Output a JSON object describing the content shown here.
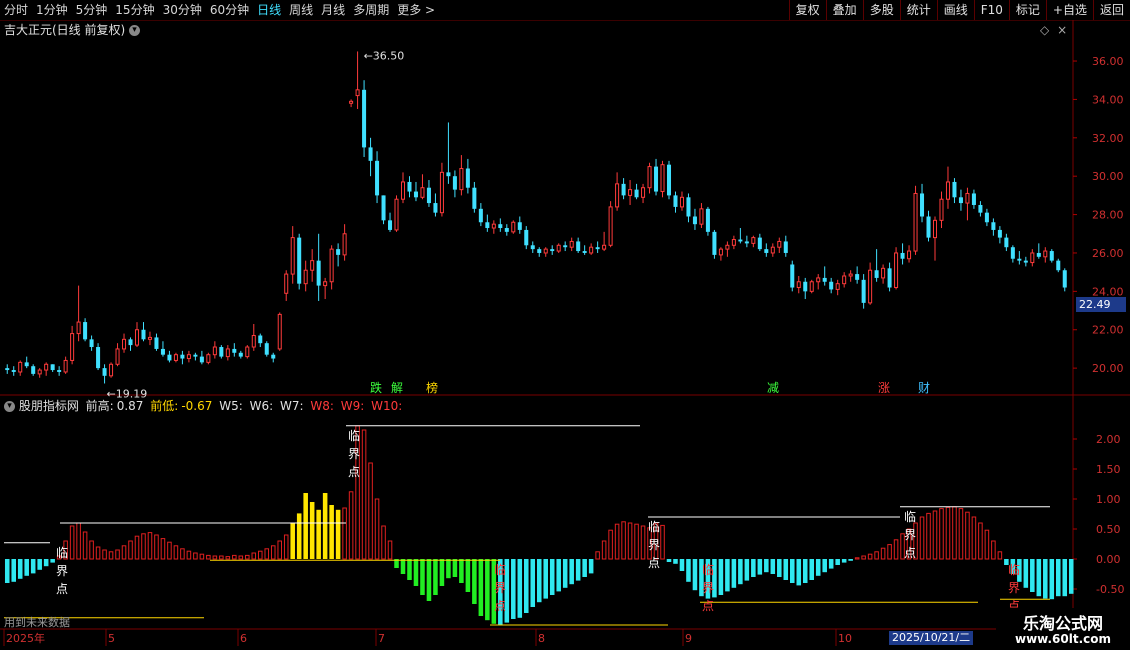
{
  "toolbar": {
    "periods": [
      "分时",
      "1分钟",
      "5分钟",
      "15分钟",
      "30分钟",
      "60分钟",
      "日线",
      "周线",
      "月线",
      "多周期",
      "更多 >"
    ],
    "active_period": "日线",
    "buttons": [
      "复权",
      "叠加",
      "多股",
      "统计",
      "画线",
      "F10",
      "标记",
      "+自选",
      "返回"
    ]
  },
  "main_header": {
    "title": "吉大正元(日线 前复权)"
  },
  "main_chart": {
    "ylim": [
      18.6,
      37.2
    ],
    "yticks": [
      "36.00",
      "34.00",
      "32.00",
      "30.00",
      "28.00",
      "26.00",
      "24.00",
      "22.00",
      "20.00"
    ],
    "ytick_values": [
      36,
      34,
      32,
      30,
      28,
      26,
      24,
      22,
      20
    ],
    "high_label": "36.50",
    "low_label": "19.19",
    "current_price": "22.49",
    "up_color": "#ff3b3b",
    "down_color": "#40e0ff",
    "event_labels": [
      {
        "text": "跌",
        "color": "#3cff3c"
      },
      {
        "text": "解",
        "color": "#3cff3c"
      },
      {
        "text": "榜",
        "color": "#ffd700"
      },
      {
        "text": "减",
        "color": "#3cff3c"
      },
      {
        "text": "涨",
        "color": "#ff3b3b"
      },
      {
        "text": "财",
        "color": "#40c0ff"
      }
    ]
  },
  "indicator_header": {
    "name": "股朋指标网",
    "prev_high_label": "前高:",
    "prev_high_value": "0.87",
    "prev_low_label": "前低:",
    "prev_low_value": "-0.67",
    "w5": "W5:",
    "w6": "W6:",
    "w7": "W7:",
    "w8": "W8:",
    "w9": "W9:",
    "w10": "W10:"
  },
  "indicator_chart": {
    "ylim": [
      -1.15,
      2.45
    ],
    "yticks": [
      "2.00",
      "1.50",
      "1.00",
      "0.50",
      "0.00",
      "-0.50"
    ],
    "ytick_values": [
      2.0,
      1.5,
      1.0,
      0.5,
      0.0,
      -0.5
    ],
    "marker_labels": [
      "临",
      "界",
      "点"
    ],
    "future_note": "用到未来数据"
  },
  "xaxis": {
    "labels": [
      "2025年",
      "5",
      "6",
      "7",
      "8",
      "9",
      "10"
    ],
    "cursor_date": "2025/10/21/二"
  },
  "watermark": {
    "title": "乐淘公式网",
    "url": "www.60lt.com"
  },
  "chart_data": {
    "type": "candlestick",
    "candles": [
      [
        20.0,
        20.2,
        19.7,
        19.9
      ],
      [
        19.9,
        20.1,
        19.6,
        19.8
      ],
      [
        19.8,
        20.4,
        19.6,
        20.3
      ],
      [
        20.3,
        20.6,
        20.0,
        20.1
      ],
      [
        20.1,
        20.2,
        19.6,
        19.7
      ],
      [
        19.7,
        20.0,
        19.5,
        19.9
      ],
      [
        19.9,
        20.3,
        19.6,
        20.2
      ],
      [
        20.2,
        20.2,
        19.8,
        19.9
      ],
      [
        19.9,
        20.1,
        19.6,
        19.8
      ],
      [
        19.8,
        20.6,
        19.7,
        20.4
      ],
      [
        20.4,
        22.2,
        20.2,
        21.8
      ],
      [
        21.8,
        24.3,
        21.4,
        22.4
      ],
      [
        22.4,
        22.6,
        21.4,
        21.5
      ],
      [
        21.5,
        21.7,
        20.9,
        21.1
      ],
      [
        21.1,
        21.3,
        19.9,
        20.0
      ],
      [
        20.0,
        20.2,
        19.2,
        19.6
      ],
      [
        19.6,
        20.3,
        19.5,
        20.2
      ],
      [
        20.2,
        21.3,
        20.1,
        21.0
      ],
      [
        21.0,
        21.8,
        20.8,
        21.5
      ],
      [
        21.5,
        21.6,
        20.9,
        21.2
      ],
      [
        21.2,
        22.4,
        21.1,
        22.0
      ],
      [
        22.0,
        22.4,
        21.4,
        21.5
      ],
      [
        21.5,
        21.9,
        21.2,
        21.6
      ],
      [
        21.6,
        21.8,
        20.9,
        21.0
      ],
      [
        21.0,
        21.4,
        20.6,
        20.7
      ],
      [
        20.7,
        20.9,
        20.3,
        20.4
      ],
      [
        20.4,
        20.8,
        20.3,
        20.7
      ],
      [
        20.7,
        20.9,
        20.2,
        20.5
      ],
      [
        20.5,
        20.9,
        20.3,
        20.7
      ],
      [
        20.7,
        20.8,
        20.4,
        20.6
      ],
      [
        20.6,
        20.9,
        20.2,
        20.3
      ],
      [
        20.3,
        20.8,
        20.2,
        20.7
      ],
      [
        20.7,
        21.4,
        20.5,
        21.1
      ],
      [
        21.1,
        21.2,
        20.5,
        20.6
      ],
      [
        20.6,
        21.2,
        20.4,
        21.0
      ],
      [
        21.0,
        21.3,
        20.6,
        20.8
      ],
      [
        20.8,
        20.9,
        20.5,
        20.6
      ],
      [
        20.6,
        21.2,
        20.5,
        21.1
      ],
      [
        21.1,
        22.3,
        20.9,
        21.7
      ],
      [
        21.7,
        21.8,
        21.1,
        21.3
      ],
      [
        21.3,
        21.4,
        20.6,
        20.7
      ],
      [
        20.7,
        20.8,
        20.3,
        20.5
      ],
      [
        21.0,
        22.9,
        20.9,
        22.8
      ],
      [
        23.9,
        25.1,
        23.5,
        24.9
      ],
      [
        24.9,
        27.4,
        24.4,
        26.8
      ],
      [
        26.8,
        27.0,
        24.1,
        24.4
      ],
      [
        24.4,
        25.6,
        24.0,
        25.1
      ],
      [
        25.1,
        26.2,
        24.5,
        25.6
      ],
      [
        25.6,
        27.0,
        23.5,
        24.3
      ],
      [
        24.3,
        24.7,
        23.6,
        24.5
      ],
      [
        24.5,
        26.4,
        24.1,
        26.2
      ],
      [
        26.2,
        26.5,
        25.3,
        25.9
      ],
      [
        25.9,
        27.5,
        25.6,
        27.0
      ],
      [
        33.8,
        34.0,
        33.6,
        33.9
      ],
      [
        34.2,
        36.5,
        33.5,
        34.5
      ],
      [
        34.5,
        35.0,
        31.0,
        31.5
      ],
      [
        31.5,
        32.0,
        30.0,
        30.8
      ],
      [
        30.8,
        31.3,
        28.6,
        29.0
      ],
      [
        29.0,
        29.0,
        27.5,
        27.7
      ],
      [
        27.7,
        28.1,
        27.1,
        27.2
      ],
      [
        27.2,
        29.0,
        27.1,
        28.8
      ],
      [
        28.8,
        30.2,
        28.6,
        29.7
      ],
      [
        29.7,
        30.0,
        28.9,
        29.2
      ],
      [
        29.2,
        29.7,
        28.7,
        28.9
      ],
      [
        28.9,
        30.1,
        28.8,
        29.4
      ],
      [
        29.4,
        29.8,
        28.4,
        28.6
      ],
      [
        28.6,
        29.1,
        27.9,
        28.1
      ],
      [
        28.1,
        30.7,
        27.9,
        30.2
      ],
      [
        30.2,
        32.8,
        29.6,
        30.0
      ],
      [
        30.0,
        30.3,
        28.9,
        29.3
      ],
      [
        29.3,
        31.1,
        29.0,
        30.4
      ],
      [
        30.4,
        30.9,
        29.1,
        29.4
      ],
      [
        29.4,
        29.7,
        28.1,
        28.3
      ],
      [
        28.3,
        28.6,
        27.4,
        27.6
      ],
      [
        27.6,
        28.0,
        27.1,
        27.3
      ],
      [
        27.3,
        27.7,
        27.0,
        27.5
      ],
      [
        27.5,
        27.8,
        27.1,
        27.3
      ],
      [
        27.3,
        27.5,
        26.9,
        27.1
      ],
      [
        27.1,
        27.7,
        27.0,
        27.6
      ],
      [
        27.6,
        27.9,
        27.0,
        27.2
      ],
      [
        27.2,
        27.4,
        26.2,
        26.4
      ],
      [
        26.4,
        26.6,
        26.0,
        26.2
      ],
      [
        26.2,
        26.3,
        25.8,
        26.0
      ],
      [
        26.0,
        26.3,
        25.8,
        26.2
      ],
      [
        26.2,
        26.4,
        25.9,
        26.1
      ],
      [
        26.1,
        26.5,
        26.0,
        26.4
      ],
      [
        26.4,
        26.6,
        26.1,
        26.3
      ],
      [
        26.3,
        26.8,
        26.1,
        26.6
      ],
      [
        26.6,
        26.8,
        26.0,
        26.1
      ],
      [
        26.1,
        26.4,
        25.9,
        26.0
      ],
      [
        26.0,
        26.5,
        25.9,
        26.3
      ],
      [
        26.3,
        26.6,
        26.0,
        26.2
      ],
      [
        26.2,
        27.1,
        26.1,
        26.4
      ],
      [
        26.4,
        28.7,
        26.3,
        28.4
      ],
      [
        28.4,
        30.2,
        28.2,
        29.6
      ],
      [
        29.6,
        29.9,
        28.8,
        29.0
      ],
      [
        29.0,
        29.8,
        28.5,
        29.3
      ],
      [
        29.3,
        29.6,
        28.8,
        28.9
      ],
      [
        28.9,
        29.6,
        28.6,
        29.4
      ],
      [
        29.4,
        30.7,
        29.1,
        30.5
      ],
      [
        30.5,
        30.9,
        29.0,
        29.2
      ],
      [
        29.2,
        30.8,
        28.9,
        30.6
      ],
      [
        30.6,
        30.8,
        28.8,
        29.0
      ],
      [
        29.0,
        29.2,
        28.1,
        28.4
      ],
      [
        28.4,
        29.2,
        28.2,
        28.9
      ],
      [
        28.9,
        29.1,
        27.6,
        27.9
      ],
      [
        27.9,
        28.3,
        27.2,
        27.5
      ],
      [
        27.5,
        28.6,
        27.3,
        28.3
      ],
      [
        28.3,
        28.4,
        26.9,
        27.1
      ],
      [
        27.1,
        27.2,
        25.7,
        25.9
      ],
      [
        25.9,
        26.3,
        25.6,
        26.2
      ],
      [
        26.2,
        26.6,
        25.8,
        26.4
      ],
      [
        26.4,
        26.9,
        26.2,
        26.7
      ],
      [
        26.7,
        27.3,
        26.5,
        26.6
      ],
      [
        26.6,
        26.9,
        26.3,
        26.5
      ],
      [
        26.5,
        26.9,
        26.3,
        26.8
      ],
      [
        26.8,
        27.0,
        26.1,
        26.2
      ],
      [
        26.2,
        26.5,
        25.8,
        26.0
      ],
      [
        26.0,
        26.5,
        25.8,
        26.3
      ],
      [
        26.3,
        26.8,
        26.0,
        26.6
      ],
      [
        26.6,
        26.9,
        25.8,
        26.0
      ],
      [
        25.4,
        25.6,
        24.0,
        24.2
      ],
      [
        24.2,
        24.8,
        23.9,
        24.5
      ],
      [
        24.5,
        24.7,
        23.6,
        24.0
      ],
      [
        24.0,
        24.6,
        23.9,
        24.5
      ],
      [
        24.5,
        24.9,
        24.1,
        24.7
      ],
      [
        24.7,
        25.3,
        24.3,
        24.5
      ],
      [
        24.5,
        24.7,
        23.9,
        24.1
      ],
      [
        24.1,
        24.6,
        23.8,
        24.4
      ],
      [
        24.4,
        25.0,
        24.2,
        24.8
      ],
      [
        24.8,
        25.1,
        24.5,
        24.9
      ],
      [
        24.9,
        25.3,
        24.4,
        24.6
      ],
      [
        24.6,
        24.9,
        23.1,
        23.4
      ],
      [
        23.4,
        25.5,
        23.3,
        25.1
      ],
      [
        25.1,
        26.2,
        24.5,
        24.7
      ],
      [
        24.7,
        25.4,
        24.4,
        25.2
      ],
      [
        25.2,
        25.5,
        24.0,
        24.2
      ],
      [
        24.2,
        26.3,
        24.1,
        26.0
      ],
      [
        26.0,
        26.5,
        25.4,
        25.7
      ],
      [
        25.7,
        26.4,
        25.5,
        26.1
      ],
      [
        26.1,
        29.5,
        25.9,
        29.1
      ],
      [
        29.1,
        29.6,
        27.6,
        27.9
      ],
      [
        27.9,
        28.2,
        26.6,
        26.8
      ],
      [
        26.8,
        27.9,
        25.6,
        27.7
      ],
      [
        27.7,
        29.2,
        27.3,
        28.8
      ],
      [
        28.8,
        30.5,
        28.3,
        29.7
      ],
      [
        29.7,
        29.9,
        28.6,
        28.9
      ],
      [
        28.9,
        29.3,
        28.2,
        28.6
      ],
      [
        28.6,
        29.4,
        27.7,
        29.1
      ],
      [
        29.1,
        29.3,
        28.3,
        28.5
      ],
      [
        28.5,
        28.7,
        27.9,
        28.1
      ],
      [
        28.1,
        28.3,
        27.4,
        27.6
      ],
      [
        27.6,
        27.8,
        26.9,
        27.2
      ],
      [
        27.2,
        27.4,
        26.5,
        26.8
      ],
      [
        26.8,
        27.0,
        26.1,
        26.3
      ],
      [
        26.3,
        26.4,
        25.5,
        25.7
      ],
      [
        25.7,
        26.1,
        25.4,
        25.6
      ],
      [
        25.6,
        25.8,
        25.3,
        25.5
      ],
      [
        25.5,
        26.2,
        25.3,
        26.0
      ],
      [
        26.0,
        26.5,
        25.7,
        25.8
      ],
      [
        25.8,
        26.3,
        25.5,
        26.1
      ],
      [
        26.1,
        26.2,
        25.5,
        25.6
      ],
      [
        25.6,
        25.7,
        25.0,
        25.1
      ],
      [
        25.1,
        25.2,
        24.0,
        24.2
      ]
    ],
    "indicator": [
      -0.4,
      -0.38,
      -0.33,
      -0.28,
      -0.24,
      -0.18,
      -0.12,
      -0.06,
      0.05,
      0.3,
      0.55,
      0.6,
      0.45,
      0.3,
      0.2,
      0.15,
      0.12,
      0.15,
      0.22,
      0.3,
      0.38,
      0.42,
      0.44,
      0.4,
      0.34,
      0.28,
      0.22,
      0.17,
      0.13,
      0.1,
      0.08,
      0.06,
      0.05,
      0.05,
      0.04,
      0.06,
      0.05,
      0.06,
      0.1,
      0.13,
      0.17,
      0.22,
      0.3,
      0.4,
      0.6,
      0.76,
      1.1,
      0.95,
      0.82,
      1.1,
      0.9,
      0.82,
      0.85,
      1.12,
      2.22,
      2.15,
      1.6,
      1.0,
      0.55,
      0.3,
      -0.15,
      -0.25,
      -0.35,
      -0.45,
      -0.6,
      -0.7,
      -0.6,
      -0.45,
      -0.32,
      -0.3,
      -0.4,
      -0.55,
      -0.75,
      -0.95,
      -1.02,
      -1.08,
      -1.1,
      -1.06,
      -1.0,
      -0.98,
      -0.9,
      -0.8,
      -0.72,
      -0.66,
      -0.6,
      -0.54,
      -0.48,
      -0.42,
      -0.36,
      -0.3,
      -0.24,
      0.12,
      0.3,
      0.48,
      0.58,
      0.62,
      0.6,
      0.58,
      0.55,
      0.52,
      0.6,
      0.56,
      -0.05,
      -0.08,
      -0.2,
      -0.38,
      -0.52,
      -0.62,
      -0.66,
      -0.64,
      -0.6,
      -0.54,
      -0.48,
      -0.42,
      -0.36,
      -0.3,
      -0.26,
      -0.22,
      -0.25,
      -0.3,
      -0.35,
      -0.4,
      -0.44,
      -0.4,
      -0.35,
      -0.28,
      -0.22,
      -0.16,
      -0.1,
      -0.06,
      -0.03,
      0.02,
      0.05,
      0.08,
      0.12,
      0.18,
      0.24,
      0.32,
      0.42,
      0.5,
      0.6,
      0.7,
      0.76,
      0.8,
      0.84,
      0.86,
      0.87,
      0.84,
      0.78,
      0.7,
      0.6,
      0.48,
      0.3,
      0.12,
      -0.1,
      -0.25,
      -0.38,
      -0.48,
      -0.55,
      -0.62,
      -0.66,
      -0.67,
      -0.62,
      -0.62,
      -0.58
    ],
    "ylabel": "",
    "xlabel": ""
  }
}
